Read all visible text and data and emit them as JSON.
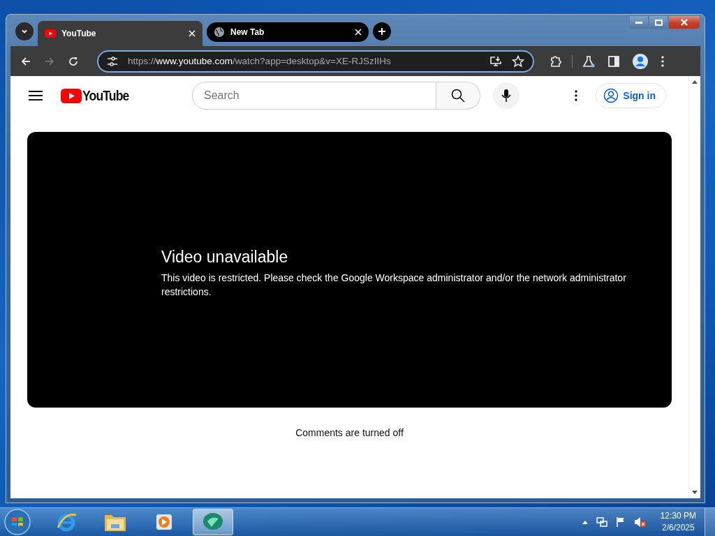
{
  "browser": {
    "tabs": [
      {
        "title": "YouTube",
        "kind": "youtube",
        "selected": true
      },
      {
        "title": "New Tab",
        "kind": "globe",
        "selected": false
      }
    ],
    "address": {
      "scheme": "https://",
      "host": "www.youtube.com",
      "path": "/watch?app=desktop&v=XE-RJSzIIHs"
    }
  },
  "page": {
    "logo": "YouTube",
    "search": {
      "placeholder": "Search"
    },
    "sign_in": "Sign in",
    "player": {
      "title": "Video unavailable",
      "message": "This video is restricted. Please check the Google Workspace administrator and/or the network administrator restrictions."
    },
    "comments": "Comments are turned off"
  },
  "taskbar": {
    "apps": [
      {
        "kind": "ie",
        "selected": false
      },
      {
        "kind": "folder",
        "selected": false
      },
      {
        "kind": "media",
        "selected": false
      },
      {
        "kind": "chat",
        "selected": true
      }
    ],
    "clock": {
      "time": "12:30 PM",
      "date": "2/6/2025"
    }
  }
}
